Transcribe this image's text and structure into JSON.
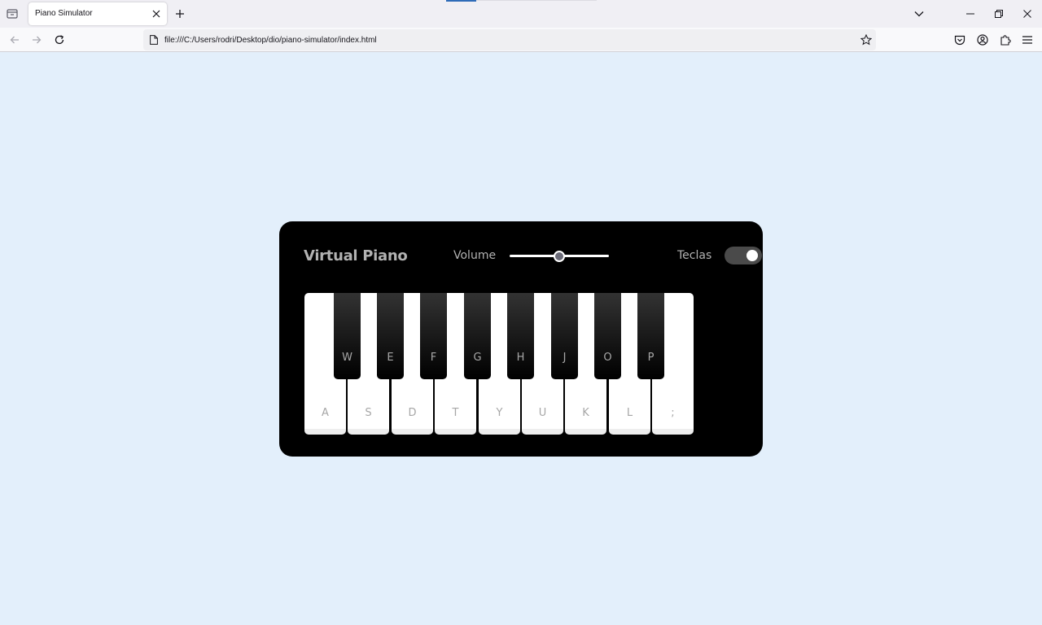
{
  "browser": {
    "tab": {
      "title": "Piano Simulator"
    },
    "url": "file:///C:/Users/rodri/Desktop/dio/piano-simulator/index.html",
    "icons": {
      "tab_list": "tab-list-icon",
      "close_tab": "close-icon",
      "new_tab": "plus-icon",
      "list_all_tabs": "chevron-down-icon",
      "minimize": "minimize-icon",
      "restore": "restore-icon",
      "close_window": "close-icon",
      "back": "arrow-left-icon",
      "forward": "arrow-right-icon",
      "reload": "reload-icon",
      "page": "page-icon",
      "bookmark": "star-icon",
      "pocket": "pocket-icon",
      "account": "account-icon",
      "extensions": "puzzle-icon",
      "menu": "hamburger-icon"
    }
  },
  "page": {
    "background": "#e3effb",
    "piano": {
      "title": "Virtual Piano",
      "volume": {
        "label": "Volume",
        "value": 0.5
      },
      "keys_toggle": {
        "label": "Teclas",
        "on": true
      },
      "white_keys": [
        "A",
        "S",
        "D",
        "T",
        "Y",
        "U",
        "K",
        "L",
        ";"
      ],
      "black_keys": [
        "W",
        "E",
        "F",
        "G",
        "H",
        "J",
        "O",
        "P"
      ]
    }
  }
}
